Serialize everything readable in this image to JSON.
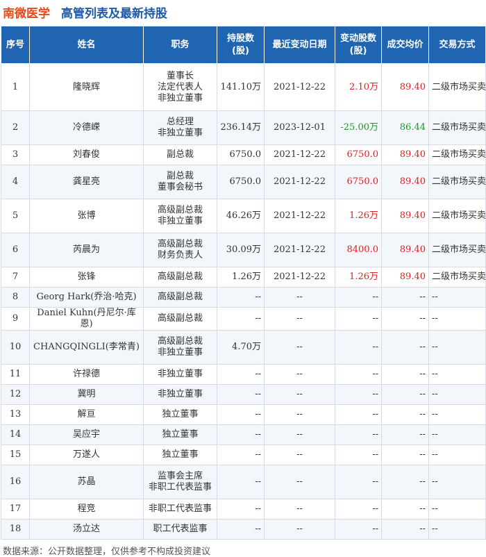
{
  "header": {
    "company": "南微医学",
    "title": "高管列表及最新持股"
  },
  "columns": [
    "序号",
    "姓名",
    "职务",
    "持股数\n(股)",
    "最近变动日期",
    "变动股数\n(股)",
    "成交均价",
    "交易方式"
  ],
  "colors": {
    "header_bg": "#1f65b1",
    "company": "#e8491d",
    "title": "#1e5aa8",
    "increase": "#e02020",
    "decrease": "#1a9a2a"
  },
  "rows": [
    {
      "no": "1",
      "name": "隆晓辉",
      "roles": [
        "董事长",
        "法定代表人",
        "非独立董事"
      ],
      "shares": "141.10万",
      "date": "2021-12-22",
      "change": "2.10万",
      "price": "89.40",
      "mode": "二级市场买卖",
      "dir": "up",
      "h": 68
    },
    {
      "no": "2",
      "name": "冷德嵘",
      "roles": [
        "总经理",
        "非独立董事"
      ],
      "shares": "236.14万",
      "date": "2023-12-01",
      "change": "-25.00万",
      "price": "86.44",
      "mode": "二级市场买卖",
      "dir": "down",
      "h": 49
    },
    {
      "no": "3",
      "name": "刘春俊",
      "roles": [
        "副总裁"
      ],
      "shares": "6750.0",
      "date": "2021-12-22",
      "change": "6750.0",
      "price": "89.40",
      "mode": "二级市场买卖",
      "dir": "up",
      "h": 29
    },
    {
      "no": "4",
      "name": "龚星亮",
      "roles": [
        "副总裁",
        "董事会秘书"
      ],
      "shares": "6750.0",
      "date": "2021-12-22",
      "change": "6750.0",
      "price": "89.40",
      "mode": "二级市场买卖",
      "dir": "up",
      "h": 49
    },
    {
      "no": "5",
      "name": "张博",
      "roles": [
        "高级副总裁",
        "非独立董事"
      ],
      "shares": "46.26万",
      "date": "2021-12-22",
      "change": "1.26万",
      "price": "89.40",
      "mode": "二级市场买卖",
      "dir": "up",
      "h": 49
    },
    {
      "no": "6",
      "name": "芮晨为",
      "roles": [
        "高级副总裁",
        "财务负责人"
      ],
      "shares": "30.09万",
      "date": "2021-12-22",
      "change": "8400.0",
      "price": "89.40",
      "mode": "二级市场买卖",
      "dir": "up",
      "h": 49
    },
    {
      "no": "7",
      "name": "张锋",
      "roles": [
        "高级副总裁"
      ],
      "shares": "1.26万",
      "date": "2021-12-22",
      "change": "1.26万",
      "price": "89.40",
      "mode": "二级市场买卖",
      "dir": "up",
      "h": 29
    },
    {
      "no": "8",
      "name": "Georg Hark(乔治·哈克)",
      "roles": [
        "高级副总裁"
      ],
      "shares": "--",
      "date": "--",
      "change": "--",
      "price": "--",
      "mode": "--",
      "dir": "none",
      "h": 29
    },
    {
      "no": "9",
      "name": "Daniel Kuhn(丹尼尔·库恩)",
      "roles": [
        "高级副总裁"
      ],
      "shares": "--",
      "date": "--",
      "change": "--",
      "price": "--",
      "mode": "--",
      "dir": "none",
      "h": 29
    },
    {
      "no": "10",
      "name": "CHANGQINGLI(李常青)",
      "roles": [
        "高级副总裁",
        "非独立董事"
      ],
      "shares": "4.70万",
      "date": "--",
      "change": "--",
      "price": "--",
      "mode": "--",
      "dir": "none",
      "h": 49
    },
    {
      "no": "11",
      "name": "许禄德",
      "roles": [
        "非独立董事"
      ],
      "shares": "--",
      "date": "--",
      "change": "--",
      "price": "--",
      "mode": "--",
      "dir": "none",
      "h": 29
    },
    {
      "no": "12",
      "name": "冀明",
      "roles": [
        "非独立董事"
      ],
      "shares": "--",
      "date": "--",
      "change": "--",
      "price": "--",
      "mode": "--",
      "dir": "none",
      "h": 29
    },
    {
      "no": "13",
      "name": "解亘",
      "roles": [
        "独立董事"
      ],
      "shares": "--",
      "date": "--",
      "change": "--",
      "price": "--",
      "mode": "--",
      "dir": "none",
      "h": 29
    },
    {
      "no": "14",
      "name": "吴应宇",
      "roles": [
        "独立董事"
      ],
      "shares": "--",
      "date": "--",
      "change": "--",
      "price": "--",
      "mode": "--",
      "dir": "none",
      "h": 29
    },
    {
      "no": "15",
      "name": "万遂人",
      "roles": [
        "独立董事"
      ],
      "shares": "--",
      "date": "--",
      "change": "--",
      "price": "--",
      "mode": "--",
      "dir": "none",
      "h": 29
    },
    {
      "no": "16",
      "name": "苏晶",
      "roles": [
        "监事会主席",
        "非职工代表监事"
      ],
      "shares": "--",
      "date": "--",
      "change": "--",
      "price": "--",
      "mode": "--",
      "dir": "none",
      "h": 49
    },
    {
      "no": "17",
      "name": "程竞",
      "roles": [
        "非职工代表监事"
      ],
      "shares": "--",
      "date": "--",
      "change": "--",
      "price": "--",
      "mode": "--",
      "dir": "none",
      "h": 29
    },
    {
      "no": "18",
      "name": "汤立达",
      "roles": [
        "职工代表监事"
      ],
      "shares": "--",
      "date": "--",
      "change": "--",
      "price": "--",
      "mode": "--",
      "dir": "none",
      "h": 29
    }
  ],
  "footer": "数据来源：公开数据整理，仅供参考不构成投资建议"
}
